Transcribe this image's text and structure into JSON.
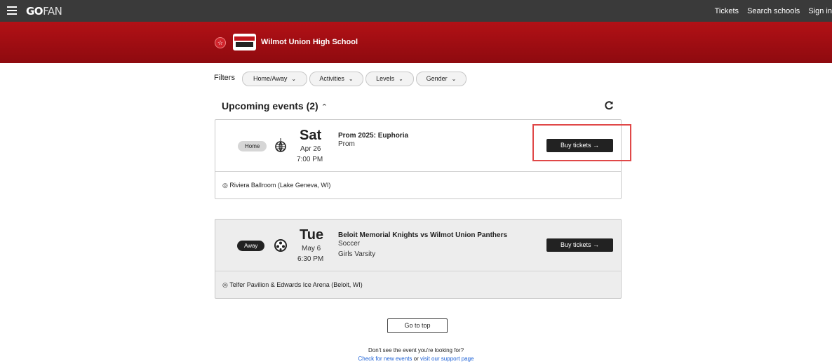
{
  "nav": {
    "logo_bold": "GO",
    "logo_thin": "FAN",
    "links": [
      "Tickets",
      "Search schools",
      "Sign in"
    ]
  },
  "school": {
    "name": "Wilmot Union High School",
    "favorite_icon": "star-icon",
    "brand_color": "#b21116"
  },
  "filters": {
    "label": "Filters",
    "chips": [
      {
        "label": "Home/Away"
      },
      {
        "label": "Activities"
      },
      {
        "label": "Levels"
      },
      {
        "label": "Gender"
      }
    ]
  },
  "upcoming": {
    "heading": "Upcoming events (2)",
    "toggle_glyph": "^",
    "refresh_glyph": "C"
  },
  "events": [
    {
      "badge": "Home",
      "icon": "disco-ball-icon",
      "day": "Sat",
      "date": "Apr 26",
      "time": "7:00 PM",
      "title": "Prom 2025: Euphoria",
      "activity": "Prom",
      "level": "",
      "buy_label": "Buy tickets →",
      "location": "Riviera Ballroom (Lake Geneva, WI)"
    },
    {
      "badge": "Away",
      "icon": "soccer-ball-icon",
      "day": "Tue",
      "date": "May 6",
      "time": "6:30 PM",
      "title": "Beloit Memorial Knights vs Wilmot Union Panthers",
      "activity": "Soccer",
      "level": "Girls Varsity",
      "buy_label": "Buy tickets →",
      "location": "Telfer Pavilion & Edwards Ice Arena (Beloit, WI)"
    }
  ],
  "footer": {
    "go_top": "Go to top",
    "prompt": "Don't see the event you're looking for?",
    "link1": "Check for new events",
    "or_text": "or",
    "link2": "visit our support page"
  }
}
